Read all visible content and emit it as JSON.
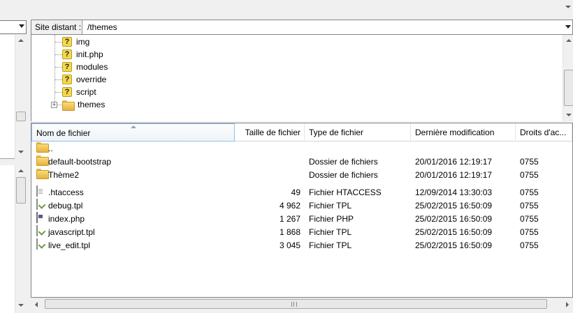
{
  "remote_site": {
    "label": "Site distant :",
    "path": "/themes"
  },
  "tree": {
    "items": [
      {
        "label": "img",
        "icon": "unknown-folder-icon"
      },
      {
        "label": "init.php",
        "icon": "unknown-folder-icon"
      },
      {
        "label": "modules",
        "icon": "unknown-folder-icon"
      },
      {
        "label": "override",
        "icon": "unknown-folder-icon"
      },
      {
        "label": "script",
        "icon": "unknown-folder-icon"
      },
      {
        "label": "themes",
        "icon": "folder-icon",
        "expander": "+"
      }
    ]
  },
  "file_list": {
    "columns": [
      "Nom de fichier",
      "Taille de fichier",
      "Type de fichier",
      "Dernière modification",
      "Droits d'ac..."
    ],
    "rows": [
      {
        "name": "..",
        "size": "",
        "type": "",
        "modified": "",
        "perms": "",
        "icon": "folder-icon"
      },
      {
        "name": "default-bootstrap",
        "size": "",
        "type": "Dossier de fichiers",
        "modified": "20/01/2016 12:19:17",
        "perms": "0755",
        "icon": "folder-icon"
      },
      {
        "name": "Thème2",
        "size": "",
        "type": "Dossier de fichiers",
        "modified": "20/01/2016 12:19:17",
        "perms": "0755",
        "icon": "folder-icon"
      },
      {
        "name": ".htaccess",
        "size": "49",
        "type": "Fichier HTACCESS",
        "modified": "12/09/2014 13:30:03",
        "perms": "0755",
        "icon": "file-icon"
      },
      {
        "name": "debug.tpl",
        "size": "4 962",
        "type": "Fichier TPL",
        "modified": "25/02/2015 16:50:09",
        "perms": "0755",
        "icon": "tpl-file-icon"
      },
      {
        "name": "index.php",
        "size": "1 267",
        "type": "Fichier PHP",
        "modified": "25/02/2015 16:50:09",
        "perms": "0755",
        "icon": "php-file-icon"
      },
      {
        "name": "javascript.tpl",
        "size": "1 868",
        "type": "Fichier TPL",
        "modified": "25/02/2015 16:50:09",
        "perms": "0755",
        "icon": "tpl-file-icon"
      },
      {
        "name": "live_edit.tpl",
        "size": "3 045",
        "type": "Fichier TPL",
        "modified": "25/02/2015 16:50:09",
        "perms": "0755",
        "icon": "tpl-file-icon"
      }
    ]
  }
}
